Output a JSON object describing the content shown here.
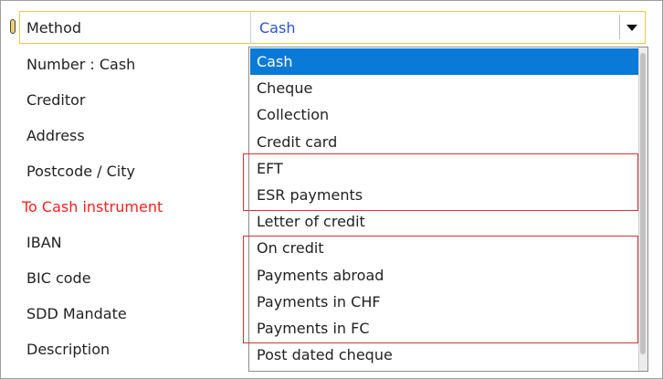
{
  "method": {
    "label": "Method",
    "value": "Cash"
  },
  "fields": [
    {
      "label": "Number : Cash"
    },
    {
      "label": "Creditor"
    },
    {
      "label": "Address"
    },
    {
      "label": "Postcode / City"
    },
    {
      "label": "To Cash instrument"
    },
    {
      "label": "IBAN"
    },
    {
      "label": "BIC code"
    },
    {
      "label": "SDD Mandate"
    },
    {
      "label": "Description"
    }
  ],
  "dropdown": {
    "options": [
      "Cash",
      "Cheque",
      "Collection",
      "Credit card",
      "EFT",
      "ESR payments",
      "Letter of credit",
      "On credit",
      "Payments abroad",
      "Payments in CHF",
      "Payments in FC",
      "Post dated cheque"
    ],
    "selected": "Cash"
  },
  "colors": {
    "selected_bg": "#0a7ad8",
    "highlight_border": "#e0303a",
    "section_label": "#ff2020",
    "method_value": "#2a54d6",
    "focus_border": "#e8c84a"
  }
}
